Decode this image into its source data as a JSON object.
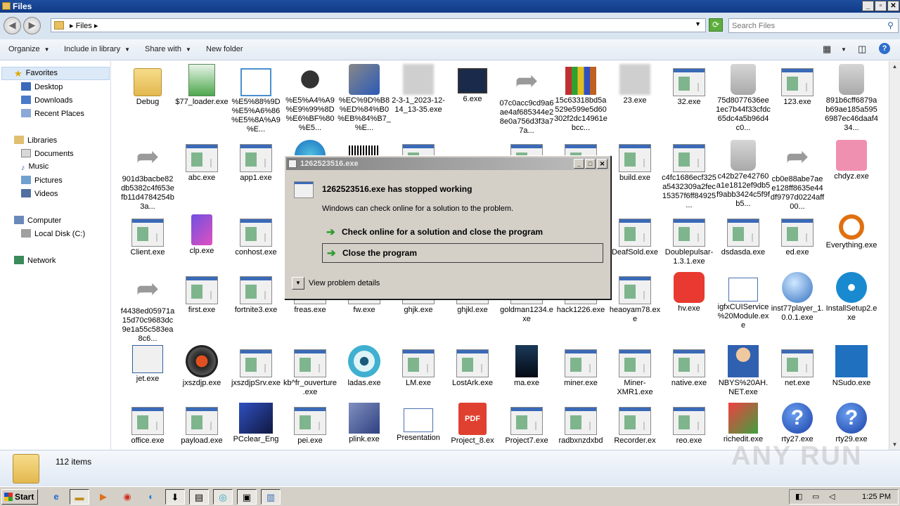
{
  "window": {
    "title": "Files"
  },
  "address": {
    "path": "Files",
    "search_placeholder": "Search Files"
  },
  "toolbar": {
    "organize": "Organize",
    "include": "Include in library",
    "share": "Share with",
    "newfolder": "New folder"
  },
  "sidebar": {
    "favorites": "Favorites",
    "desktop": "Desktop",
    "downloads": "Downloads",
    "recent": "Recent Places",
    "libraries": "Libraries",
    "documents": "Documents",
    "music": "Music",
    "pictures": "Pictures",
    "videos": "Videos",
    "computer": "Computer",
    "localdisk": "Local Disk (C:)",
    "network": "Network"
  },
  "files": [
    {
      "label": "Debug",
      "icon": "folder"
    },
    {
      "label": "$77_loader.exe",
      "icon": "green"
    },
    {
      "label": "%E5%88%9D%E5%A6%86%E5%8A%A9%E...",
      "icon": "download"
    },
    {
      "label": "%E5%A4%A9%E9%99%8D%E6%BF%80%E5...",
      "icon": "skull"
    },
    {
      "label": "%EC%9D%B8%ED%84%B0%EB%84%B7_%E...",
      "icon": "app"
    },
    {
      "label": "2-3-1_2023-12-14_13-35.exe",
      "icon": "blur"
    },
    {
      "label": "6.exe",
      "icon": "monitor"
    },
    {
      "label": "07c0acc9cd9a6ae4af685344e28e0a756d3f3a77a...",
      "icon": "arrow"
    },
    {
      "label": "15c63318bd5a529e599e5d60302f2dc14961ebcc...",
      "icon": "books"
    },
    {
      "label": "23.exe",
      "icon": "blur"
    },
    {
      "label": "32.exe",
      "icon": "exe"
    },
    {
      "label": "75d8077636ee1ec7b44f33cfdc65dc4a5b96d4c0...",
      "icon": "bin"
    },
    {
      "label": "123.exe",
      "icon": "exe"
    },
    {
      "label": "891b6cff6879ab69ae185a5956987ec46daaf434...",
      "icon": "bin"
    },
    {
      "label": "901d3bacbe82db5382c4f653efb11d4784254b3a...",
      "icon": "arrow"
    },
    {
      "label": "abc.exe",
      "icon": "exe"
    },
    {
      "label": "app1.exe",
      "icon": "exe"
    },
    {
      "label": "",
      "icon": "edge"
    },
    {
      "label": "",
      "icon": "barcode"
    },
    {
      "label": "",
      "icon": "exe"
    },
    {
      "label": "",
      "icon": "none"
    },
    {
      "label": "",
      "icon": "exe"
    },
    {
      "label": "",
      "icon": "exe"
    },
    {
      "label": "build.exe",
      "icon": "exe"
    },
    {
      "label": "c4fc1686ecf325a5432309a2fec15357f6ff84925...",
      "icon": "exe"
    },
    {
      "label": "c42b27e42760a1e1812ef9db5f9abb3424c5f9fb5...",
      "icon": "bin"
    },
    {
      "label": "cb0e88abe7aee128ff8635e44df9797d0224aff00...",
      "icon": "arrow"
    },
    {
      "label": "chdyz.exe",
      "icon": "chdyz"
    },
    {
      "label": "Client.exe",
      "icon": "exe"
    },
    {
      "label": "clp.exe",
      "icon": "clp"
    },
    {
      "label": "conhost.exe",
      "icon": "exe"
    },
    {
      "label": "",
      "icon": "none"
    },
    {
      "label": "",
      "icon": "none"
    },
    {
      "label": "",
      "icon": "none"
    },
    {
      "label": "",
      "icon": "none"
    },
    {
      "label": "",
      "icon": "none"
    },
    {
      "label": "",
      "icon": "none"
    },
    {
      "label": "DeafSold.exe",
      "icon": "exe"
    },
    {
      "label": "Doublepulsar-1.3.1.exe",
      "icon": "exe"
    },
    {
      "label": "dsdasda.exe",
      "icon": "exe"
    },
    {
      "label": "ed.exe",
      "icon": "exe"
    },
    {
      "label": "Everything.exe",
      "icon": "search"
    },
    {
      "label": "f4438ed05971a15d70c9683dc9e1a55c583ea8c6...",
      "icon": "arrow"
    },
    {
      "label": "first.exe",
      "icon": "exe"
    },
    {
      "label": "fortnite3.exe",
      "icon": "exe"
    },
    {
      "label": "freas.exe",
      "icon": "exe"
    },
    {
      "label": "fw.exe",
      "icon": "exe"
    },
    {
      "label": "ghjk.exe",
      "icon": "exe"
    },
    {
      "label": "ghjkl.exe",
      "icon": "exe"
    },
    {
      "label": "goldman1234.exe",
      "icon": "exe"
    },
    {
      "label": "hack1226.exe",
      "icon": "exe"
    },
    {
      "label": "heaoyam78.exe",
      "icon": "exe"
    },
    {
      "label": "hv.exe",
      "icon": "hv"
    },
    {
      "label": "igfxCUIService%20Module.exe",
      "icon": "window"
    },
    {
      "label": "inst77player_1.0.0.1.exe",
      "icon": "globe"
    },
    {
      "label": "InstallSetup2.exe",
      "icon": "wifi"
    },
    {
      "label": "jet.exe",
      "icon": "jet"
    },
    {
      "label": "jxszdjp.exe",
      "icon": "disc"
    },
    {
      "label": "jxszdjpSrv.exe",
      "icon": "exe"
    },
    {
      "label": "kb^fr_ouverture.exe",
      "icon": "exe"
    },
    {
      "label": "ladas.exe",
      "icon": "eye"
    },
    {
      "label": "LM.exe",
      "icon": "exe"
    },
    {
      "label": "LostArk.exe",
      "icon": "exe"
    },
    {
      "label": "ma.exe",
      "icon": "dark"
    },
    {
      "label": "miner.exe",
      "icon": "exe"
    },
    {
      "label": "Miner-XMR1.exe",
      "icon": "exe"
    },
    {
      "label": "native.exe",
      "icon": "exe"
    },
    {
      "label": "NBYS%20AH.NET.exe",
      "icon": "person"
    },
    {
      "label": "net.exe",
      "icon": "exe"
    },
    {
      "label": "NSudo.exe",
      "icon": "gear"
    },
    {
      "label": "office.exe",
      "icon": "exe"
    },
    {
      "label": "payload.exe",
      "icon": "exe"
    },
    {
      "label": "PCclear_Eng",
      "icon": "cube"
    },
    {
      "label": "pei.exe",
      "icon": "exe"
    },
    {
      "label": "plink.exe",
      "icon": "plink"
    },
    {
      "label": "Presentation",
      "icon": "window"
    },
    {
      "label": "Project_8.ex",
      "icon": "pdf"
    },
    {
      "label": "Project7.exe",
      "icon": "exe"
    },
    {
      "label": "radbxnzdxbd",
      "icon": "exe"
    },
    {
      "label": "Recorder.ex",
      "icon": "exe"
    },
    {
      "label": "reo.exe",
      "icon": "exe"
    },
    {
      "label": "richedit.exe",
      "icon": "richedit"
    },
    {
      "label": "rty27.exe",
      "icon": "question"
    },
    {
      "label": "rty29.exe",
      "icon": "question"
    }
  ],
  "status": {
    "count": "112 items"
  },
  "watermark": "ANY RUN",
  "taskbar": {
    "start": "Start",
    "time": "1:25 PM"
  },
  "dialog": {
    "title": "1262523516.exe",
    "heading": "1262523516.exe has stopped working",
    "subtitle": "Windows can check online for a solution to the problem.",
    "option1": "Check online for a solution and close the program",
    "option2": "Close the program",
    "details": "View problem details"
  }
}
